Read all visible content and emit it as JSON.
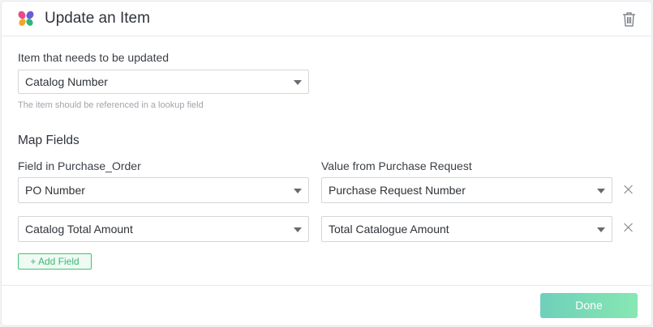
{
  "header": {
    "title": "Update an Item",
    "logo_icon": "butterfly-logo",
    "delete_icon": "trash-icon"
  },
  "item_section": {
    "label": "Item that needs to be updated",
    "selected_value": "Catalog Number",
    "hint": "The item should be referenced in a lookup field"
  },
  "map_fields": {
    "title": "Map Fields",
    "left_column_label": "Field in Purchase_Order",
    "right_column_label": "Value from Purchase Request",
    "rows": [
      {
        "field": "PO Number",
        "value": "Purchase Request Number"
      },
      {
        "field": "Catalog Total Amount",
        "value": "Total Catalogue Amount"
      }
    ],
    "add_field_label": "+ Add Field"
  },
  "footer": {
    "done_label": "Done"
  },
  "colors": {
    "accent_green": "#45c07a",
    "done_gradient_start": "#56c8ae",
    "done_gradient_end": "#72e3a6"
  }
}
